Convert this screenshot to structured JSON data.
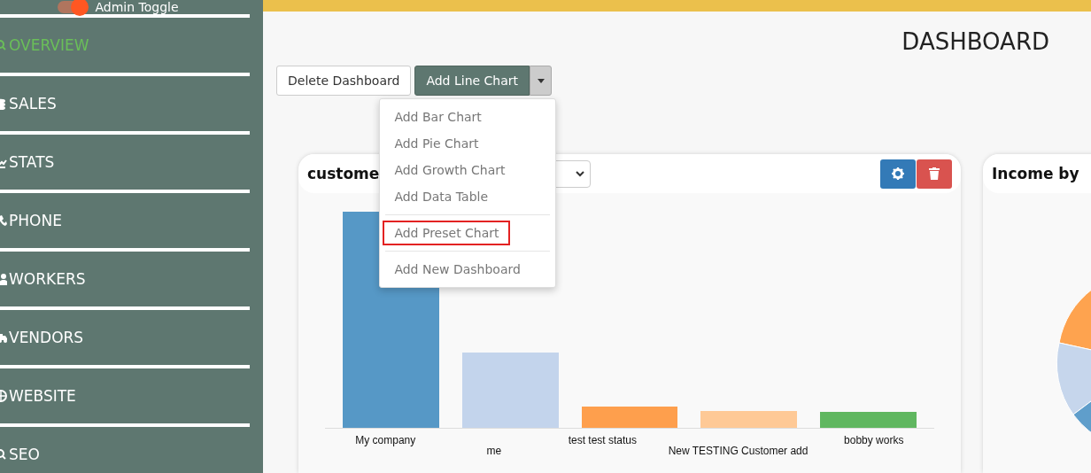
{
  "sidebar": {
    "admin_toggle": {
      "label": "Admin Toggle",
      "on": true
    },
    "items": [
      {
        "label": "OVERVIEW",
        "selected": true
      },
      {
        "label": "SALES",
        "selected": false
      },
      {
        "label": "STATS",
        "selected": false
      },
      {
        "label": "PHONE",
        "selected": false
      },
      {
        "label": "WORKERS",
        "selected": false
      },
      {
        "label": "VENDORS",
        "selected": false
      },
      {
        "label": "WEBSITE",
        "selected": false
      },
      {
        "label": "SEO",
        "selected": false
      }
    ]
  },
  "page_title": "DASHBOARD",
  "toolbar": {
    "delete_button": "Delete Dashboard",
    "split_button": "Add Line Chart"
  },
  "menu": {
    "open": true,
    "items": [
      {
        "label": "Add Bar Chart",
        "divider_before": false,
        "highlighted": false
      },
      {
        "label": "Add Pie Chart",
        "divider_before": false,
        "highlighted": false
      },
      {
        "label": "Add Growth Chart",
        "divider_before": false,
        "highlighted": false
      },
      {
        "label": "Add Data Table",
        "divider_before": false,
        "highlighted": false
      },
      {
        "label": "Add Preset Chart",
        "divider_before": true,
        "highlighted": true
      },
      {
        "label": "Add New Dashboard",
        "divider_before": true,
        "highlighted": false
      }
    ]
  },
  "cards": [
    {
      "title": "custome",
      "kind": "bar",
      "bar_labels": [
        "My company",
        "me",
        "test test status",
        "New TESTING Customer add",
        "bobby works"
      ]
    },
    {
      "title": "Income by",
      "kind": "pie"
    }
  ]
}
